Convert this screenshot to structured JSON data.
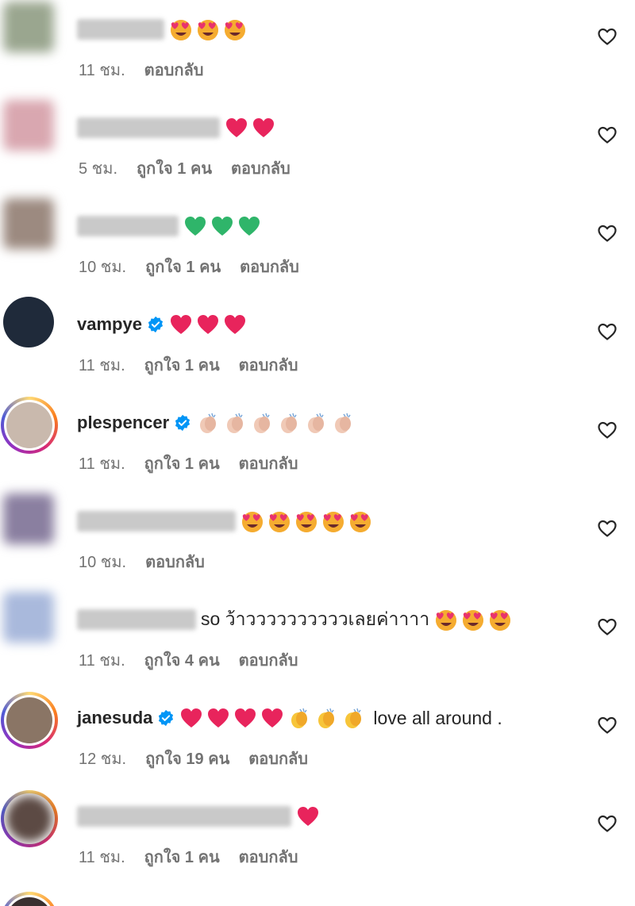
{
  "labels": {
    "reply": "ตอบกลับ",
    "like_prefix": "ถูกใจ",
    "like_suffix": "คน"
  },
  "comments": [
    {
      "username": "",
      "hidden": true,
      "verified": false,
      "text": "",
      "emojis": [
        "heart-eyes-emoji",
        "heart-eyes-emoji",
        "heart-eyes-emoji"
      ],
      "time": "11 ชม.",
      "likes": "",
      "avatar_color": "#9aa68f"
    },
    {
      "username": "",
      "hidden": true,
      "verified": false,
      "text": "",
      "emojis": [
        "red-heart-emoji",
        "red-heart-emoji"
      ],
      "time": "5 ชม.",
      "likes": "1",
      "avatar_color": "#d9a7b0"
    },
    {
      "username": "",
      "hidden": true,
      "verified": false,
      "text": "",
      "emojis": [
        "green-heart-emoji",
        "green-heart-emoji",
        "green-heart-emoji"
      ],
      "time": "10 ชม.",
      "likes": "1",
      "avatar_color": "#9c8a80"
    },
    {
      "username": "vampye",
      "hidden": false,
      "verified": true,
      "text": "",
      "emojis": [
        "red-heart-emoji",
        "red-heart-emoji",
        "red-heart-emoji"
      ],
      "time": "11 ชม.",
      "likes": "1",
      "avatar_color": "#1f2a3a"
    },
    {
      "username": "plespencer",
      "hidden": false,
      "verified": true,
      "text": "",
      "emojis": [
        "clap-emoji",
        "clap-emoji",
        "clap-emoji",
        "clap-emoji",
        "clap-emoji",
        "clap-emoji"
      ],
      "time": "11 ชม.",
      "likes": "1",
      "avatar_color": "#c9b9ad"
    },
    {
      "username": "",
      "hidden": true,
      "verified": false,
      "text": "",
      "emojis": [
        "heart-eyes-emoji",
        "heart-eyes-emoji",
        "heart-eyes-emoji",
        "heart-eyes-emoji",
        "heart-eyes-emoji"
      ],
      "time": "10 ชม.",
      "likes": "",
      "avatar_color": "#8a7fa0"
    },
    {
      "username": "",
      "hidden": true,
      "verified": false,
      "text": "so ว้าววววววววววเลยค่าาาา",
      "emojis": [
        "heart-eyes-emoji",
        "heart-eyes-emoji",
        "heart-eyes-emoji"
      ],
      "time": "11 ชม.",
      "likes": "4",
      "avatar_color": "#a9b9dc"
    },
    {
      "username": "janesuda",
      "hidden": false,
      "verified": true,
      "text": "",
      "emojis": [
        "red-heart-emoji",
        "red-heart-emoji",
        "red-heart-emoji",
        "red-heart-emoji",
        "clap-yellow-emoji",
        "clap-yellow-emoji",
        "clap-yellow-emoji"
      ],
      "text_after": "love all around .",
      "time": "12 ชม.",
      "likes": "19",
      "avatar_color": "#8a7565"
    },
    {
      "username": "",
      "hidden": true,
      "verified": false,
      "text": "",
      "emojis": [
        "red-heart-emoji"
      ],
      "time": "11 ชม.",
      "likes": "1",
      "avatar_color": "#5c4a44"
    }
  ]
}
